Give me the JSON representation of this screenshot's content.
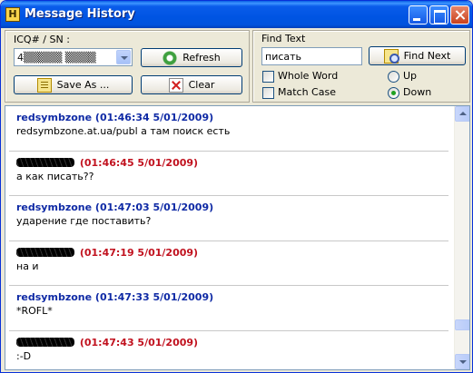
{
  "window": {
    "title": "Message History",
    "app_icon_letter": "H"
  },
  "contact": {
    "label": "ICQ# / SN :",
    "selected_value": "4▒▒▒▒▒ ▒▒▒▒"
  },
  "buttons": {
    "refresh": "Refresh",
    "save_as": "Save As ...",
    "clear": "Clear",
    "find_next": "Find Next"
  },
  "find": {
    "label": "Find Text",
    "value": "писать",
    "whole_word_label": "Whole Word",
    "match_case_label": "Match Case",
    "direction_up_label": "Up",
    "direction_down_label": "Down",
    "direction_selected": "Down",
    "whole_word_checked": false,
    "match_case_checked": false
  },
  "messages": [
    {
      "sender": "redsymbzone",
      "is_me": true,
      "timestamp": "(01:46:34 5/01/2009)",
      "text": "redsymbzone.at.ua/publ а там поиск есть"
    },
    {
      "sender": "",
      "is_me": false,
      "timestamp": "(01:46:45 5/01/2009)",
      "text": "а как писать??"
    },
    {
      "sender": "redsymbzone",
      "is_me": true,
      "timestamp": "(01:47:03 5/01/2009)",
      "text": "ударение где поставить?"
    },
    {
      "sender": "",
      "is_me": false,
      "timestamp": "(01:47:19 5/01/2009)",
      "text": "на и"
    },
    {
      "sender": "redsymbzone",
      "is_me": true,
      "timestamp": "(01:47:33 5/01/2009)",
      "text": "*ROFL*"
    },
    {
      "sender": "",
      "is_me": false,
      "timestamp": "(01:47:43 5/01/2009)",
      "text": ":-D"
    }
  ],
  "colors": {
    "my_header": "#0f2aa5",
    "their_header": "#c1121f",
    "title_bar": "#0054e3"
  }
}
